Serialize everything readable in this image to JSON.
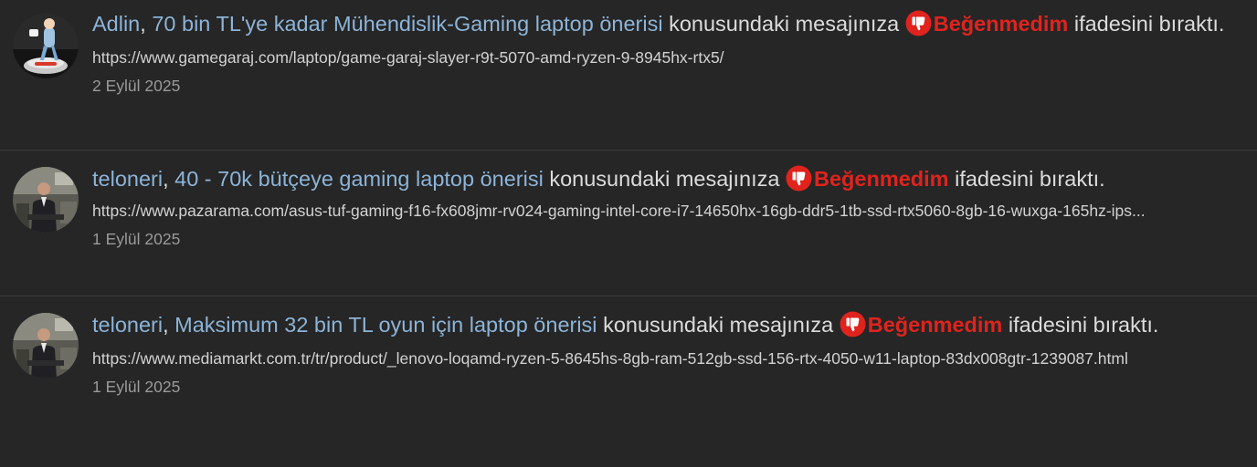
{
  "alerts": [
    {
      "user": "Adlin",
      "separator": ", ",
      "thread_title": "70 bin TL'ye kadar Mühendislik-Gaming laptop önerisi",
      "middle_text": " konusundaki mesajınıza ",
      "reaction_label": "Beğenmedim",
      "end_text": " ifadesini bıraktı.",
      "snippet": "https://www.gamegaraj.com/laptop/game-garaj-slayer-r9t-5070-amd-ryzen-9-8945hx-rtx5/",
      "date": "2 Eylül 2025"
    },
    {
      "user": "teloneri",
      "separator": ", ",
      "thread_title": "40 - 70k bütçeye gaming laptop önerisi",
      "middle_text": " konusundaki mesajınıza ",
      "reaction_label": "Beğenmedim",
      "end_text": " ifadesini bıraktı.",
      "snippet": "https://www.pazarama.com/asus-tuf-gaming-f16-fx608jmr-rv024-gaming-intel-core-i7-14650hx-16gb-ddr5-1tb-ssd-rtx5060-8gb-16-wuxga-165hz-ips...",
      "date": "1 Eylül 2025"
    },
    {
      "user": "teloneri",
      "separator": ", ",
      "thread_title": "Maksimum 32 bin TL oyun için laptop önerisi",
      "middle_text": " konusundaki mesajınıza ",
      "reaction_label": "Beğenmedim",
      "end_text": " ifadesini bıraktı.",
      "snippet": "https://www.mediamarkt.com.tr/tr/product/_lenovo-loqamd-ryzen-5-8645hs-8gb-ram-512gb-ssd-156-rtx-4050-w11-laptop-83dx008gtr-1239087.html",
      "date": "1 Eylül 2025"
    }
  ],
  "icons": {
    "reaction": "thumbs-down-icon"
  },
  "colors": {
    "background": "#262626",
    "link": "#8cb4d8",
    "reaction": "#e0231d",
    "text": "#dcdcdc",
    "muted": "#9a9a9a",
    "divider": "#3b3b3b"
  }
}
